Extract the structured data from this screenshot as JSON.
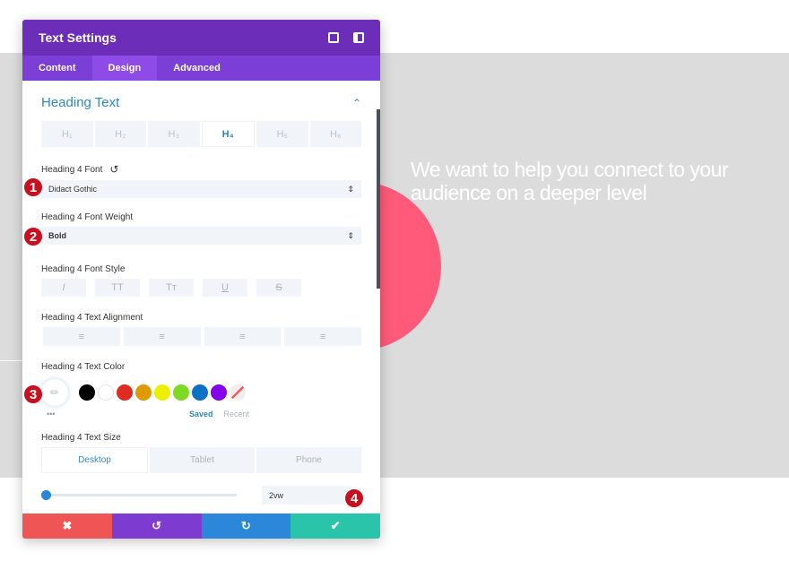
{
  "hero_text": "We want to help you connect to your audience on a deeper level",
  "panel": {
    "title": "Text Settings",
    "tabs": [
      {
        "label": "Content"
      },
      {
        "label": "Design"
      },
      {
        "label": "Advanced"
      }
    ],
    "section_title": "Heading Text",
    "heading_levels": [
      "H₁",
      "H₂",
      "H₃",
      "H₄",
      "H₅",
      "H₆"
    ],
    "font_label": "Heading 4 Font",
    "font_value": "Didact Gothic",
    "weight_label": "Heading 4 Font Weight",
    "weight_value": "Bold",
    "style_label": "Heading 4 Font Style",
    "style_buttons": [
      "I",
      "TT",
      "Tᴛ",
      "U",
      "S"
    ],
    "align_label": "Heading 4 Text Alignment",
    "align_buttons": [
      "≡",
      "≡",
      "≡",
      "≡"
    ],
    "color_label": "Heading 4 Text Color",
    "swatches": [
      "#000000",
      "#ffffff",
      "#e02b20",
      "#e09900",
      "#edf000",
      "#7cda24",
      "#0c71c3",
      "#8300e9"
    ],
    "saved": "Saved",
    "recent": "Recent",
    "more": "•••",
    "size_label": "Heading 4 Text Size",
    "devices": [
      "Desktop",
      "Tablet",
      "Phone"
    ],
    "size_value": "2vw",
    "footer": {
      "cancel": "✖",
      "undo": "↺",
      "redo": "↻",
      "save": "✔"
    }
  },
  "badges": [
    "1",
    "2",
    "3",
    "4"
  ],
  "colors": {
    "header": "#6c2eb9",
    "accent": "#2e8ab5",
    "circle": "#ff5a79"
  }
}
